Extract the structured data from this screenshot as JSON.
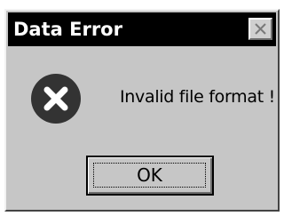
{
  "dialog": {
    "title": "Data Error",
    "message": "Invalid file format !",
    "ok_label": "OK",
    "icon": "error-x-icon",
    "close_icon": "close-icon"
  },
  "colors": {
    "dialog_face": "#c6c6c6",
    "titlebar": "#000000",
    "title_text": "#ffffff",
    "icon_circle": "#333333"
  }
}
